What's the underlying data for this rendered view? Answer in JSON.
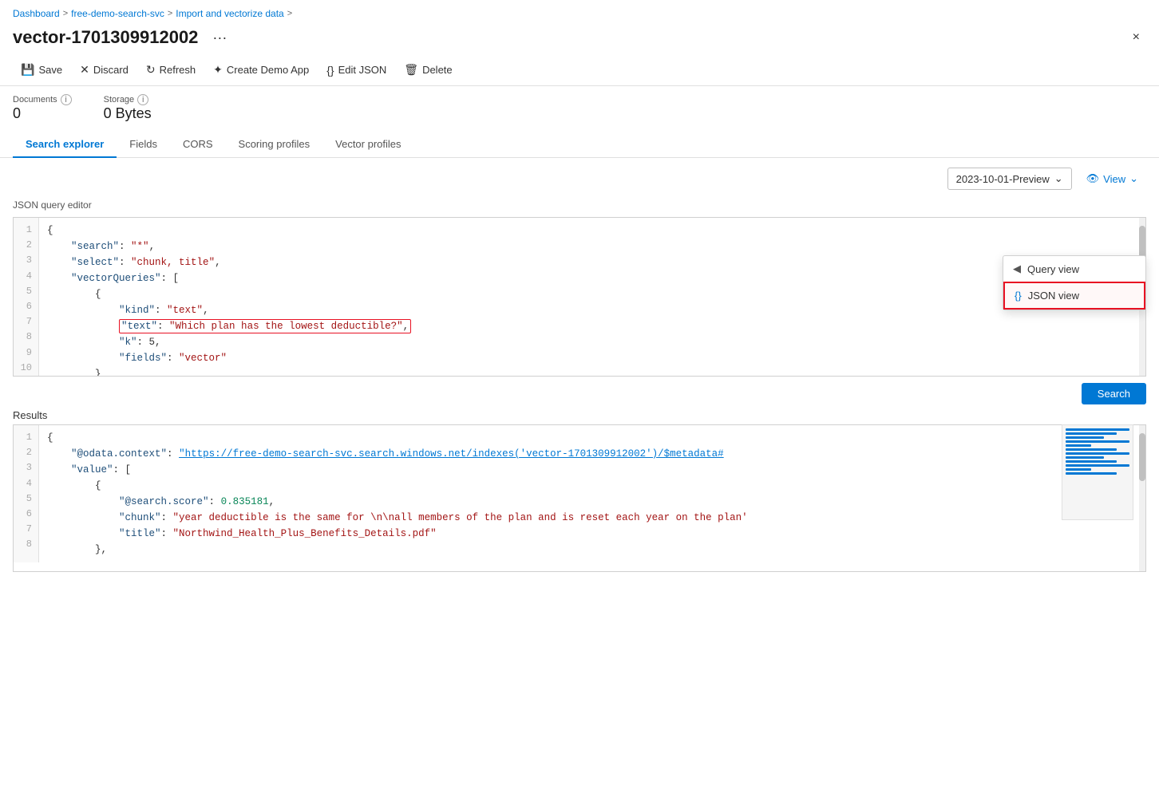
{
  "breadcrumb": {
    "items": [
      {
        "label": "Dashboard",
        "href": "#"
      },
      {
        "label": "free-demo-search-svc",
        "href": "#"
      },
      {
        "label": "Import and vectorize data",
        "href": "#"
      }
    ]
  },
  "header": {
    "title": "vector-1701309912002",
    "ellipsis": "···",
    "close_label": "×"
  },
  "toolbar": {
    "save_label": "Save",
    "discard_label": "Discard",
    "refresh_label": "Refresh",
    "create_demo_label": "Create Demo App",
    "edit_json_label": "Edit JSON",
    "delete_label": "Delete"
  },
  "stats": {
    "documents_label": "Documents",
    "storage_label": "Storage",
    "documents_value": "0",
    "storage_value": "0 Bytes"
  },
  "tabs": [
    {
      "label": "Search explorer",
      "active": true
    },
    {
      "label": "Fields",
      "active": false
    },
    {
      "label": "CORS",
      "active": false
    },
    {
      "label": "Scoring profiles",
      "active": false
    },
    {
      "label": "Vector profiles",
      "active": false
    }
  ],
  "query_toolbar": {
    "api_version": "2023-10-01-Preview",
    "view_label": "View"
  },
  "view_popup": {
    "items": [
      {
        "label": "Query view",
        "icon": "funnel"
      },
      {
        "label": "JSON view",
        "icon": "braces",
        "selected": true
      }
    ]
  },
  "editor": {
    "label": "JSON query editor",
    "lines": [
      {
        "num": 1,
        "content": "{"
      },
      {
        "num": 2,
        "content": "    \"search\": \"*\","
      },
      {
        "num": 3,
        "content": "    \"select\": \"chunk, title\","
      },
      {
        "num": 4,
        "content": "    \"vectorQueries\": ["
      },
      {
        "num": 5,
        "content": "        {"
      },
      {
        "num": 6,
        "content": "            \"kind\": \"text\","
      },
      {
        "num": 7,
        "content": "            \"text\": \"Which plan has the lowest deductible?\","
      },
      {
        "num": 8,
        "content": "            \"k\": 5,"
      },
      {
        "num": 9,
        "content": "            \"fields\": \"vector\""
      },
      {
        "num": 10,
        "content": "        }"
      }
    ]
  },
  "search_btn_label": "Search",
  "results": {
    "label": "Results",
    "lines": [
      {
        "num": 1,
        "content": "{"
      },
      {
        "num": 2,
        "content": "    \"@odata.context\": \"https://free-demo-search-svc.search.windows.net/indexes('vector-1701309912002')/$metadata#",
        "link_start": 22,
        "link_text": "https://free-demo-search-svc.search.windows.net/indexes('vector-1701309912002')/$metadata#"
      },
      {
        "num": 3,
        "content": "    \"value\": ["
      },
      {
        "num": 4,
        "content": "        {"
      },
      {
        "num": 5,
        "content": "            \"@search.score\": 0.835181,"
      },
      {
        "num": 6,
        "content": "            \"chunk\": \"year deductible is the same for \\n\\nall members of the plan and is reset each year on the plan'"
      },
      {
        "num": 7,
        "content": "            \"title\": \"Northwind_Health_Plus_Benefits_Details.pdf\""
      },
      {
        "num": 8,
        "content": "        },"
      }
    ]
  }
}
